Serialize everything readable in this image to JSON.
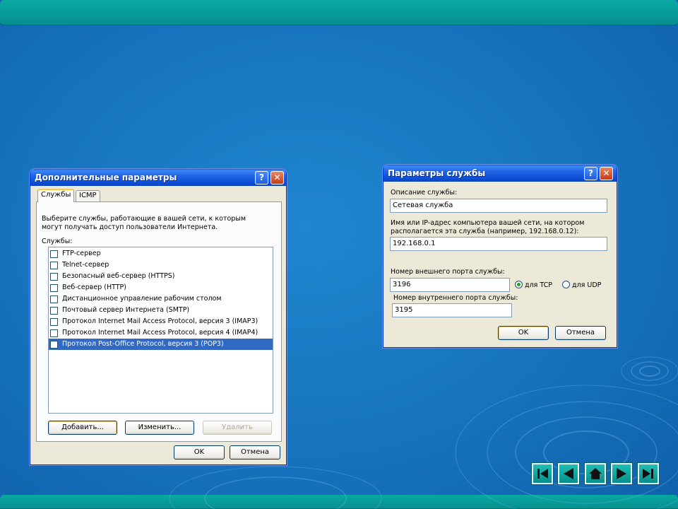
{
  "dialog1": {
    "title": "Дополнительные параметры",
    "help": "?",
    "close": "✕",
    "tabs": [
      "Службы",
      "ICMP"
    ],
    "description": "Выберите службы, работающие в вашей сети, к которым могут получать доступ пользователи Интернета.",
    "services_label": "Службы:",
    "services": [
      "FTP-сервер",
      "Telnet-сервер",
      "Безопасный веб-сервер (HTTPS)",
      "Веб-сервер (HTTP)",
      "Дистанционное управление рабочим столом",
      "Почтовый сервер Интернета (SMTP)",
      "Протокол Internet Mail Access Protocol, версия 3 (IMAP3)",
      "Протокол Internet Mail Access Protocol, версия 4 (IMAP4)",
      "Протокол Post-Office Protocol, версия 3 (POP3)"
    ],
    "add_label": "Добавить...",
    "edit_label": "Изменить...",
    "delete_label": "Удалить",
    "ok_label": "OK",
    "cancel_label": "Отмена"
  },
  "dialog2": {
    "title": "Параметры службы",
    "help": "?",
    "close": "✕",
    "desc_label": "Описание службы:",
    "desc_value": "Сетевая служба",
    "host_label_1": "Имя или IP-адрес компьютера вашей сети, на котором",
    "host_label_2": "располагается эта служба (например, 192.168.0.12):",
    "host_value": "192.168.0.1",
    "ext_port_label": "Номер внешнего порта службы:",
    "ext_port_value": "3196",
    "tcp_label": "для TCP",
    "udp_label": "для UDP",
    "int_port_label": "Номер внутреннего порта службы:",
    "int_port_value": "3195",
    "ok_label": "OK",
    "cancel_label": "Отмена"
  },
  "icons": {
    "first": "skip-first-icon",
    "prev": "prev-icon",
    "home": "home-icon",
    "next": "next-icon",
    "last": "skip-last-icon"
  },
  "colors": {
    "accent_teal": "#078f8e",
    "selection": "#316ac5",
    "xp_title": "#0d4fd6"
  }
}
